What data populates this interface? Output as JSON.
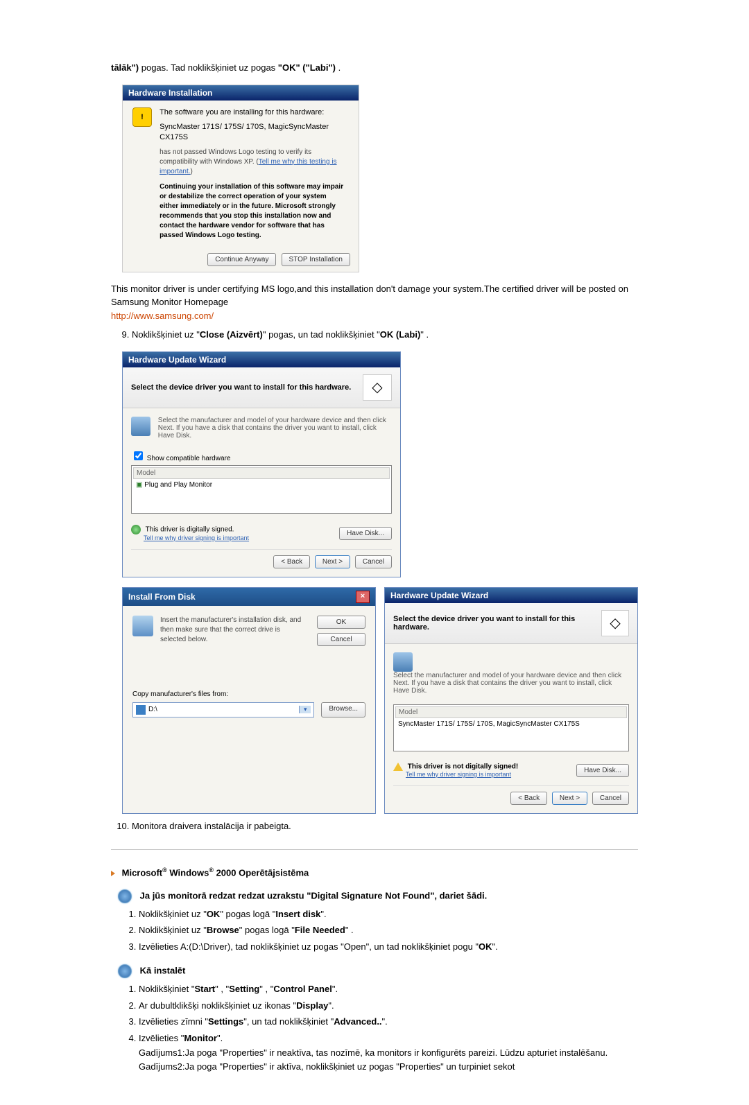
{
  "intro": {
    "line1_a": "tālāk\")",
    "line1_b": " pogas. Tad noklikšķiniet uz pogas ",
    "line1_c": "\"OK\" (\"Labi\")",
    "line1_d": " ."
  },
  "hw_install": {
    "title": "Hardware Installation",
    "l1": "The software you are installing for this hardware:",
    "l2": "SyncMaster 171S/ 175S/ 170S, MagicSyncMaster CX175S",
    "l3a": "has not passed Windows Logo testing to verify its compatibility with Windows XP. (",
    "l3link": "Tell me why this testing is important.",
    "l3b": ")",
    "bold": "Continuing your installation of this software may impair or destabilize the correct operation of your system either immediately or in the future. Microsoft strongly recommends that you stop this installation now and contact the hardware vendor for software that has passed Windows Logo testing.",
    "btn_cont": "Continue Anyway",
    "btn_stop": "STOP Installation"
  },
  "after_hw": {
    "p1": "This monitor driver is under certifying MS logo,and this installation don't damage your system.The certified driver will be posted on Samsung Monitor Homepage",
    "link": "http://www.samsung.com/"
  },
  "step9": {
    "a": "Noklikšķiniet uz \"",
    "close": "Close (Aizvērt)",
    "b": "\" pogas, un tad noklikšķiniet \"",
    "ok": "OK (Labi)",
    "c": "\" ."
  },
  "wiz1": {
    "title": "Hardware Update Wizard",
    "header": "Select the device driver you want to install for this hardware.",
    "note": "Select the manufacturer and model of your hardware device and then click Next. If you have a disk that contains the driver you want to install, click Have Disk.",
    "chk": "Show compatible hardware",
    "col": "Model",
    "row": "Plug and Play Monitor",
    "signed": "This driver is digitally signed.",
    "tell": "Tell me why driver signing is important",
    "have": "Have Disk...",
    "back": "< Back",
    "next": "Next >",
    "cancel": "Cancel"
  },
  "ifd": {
    "title": "Install From Disk",
    "text": "Insert the manufacturer's installation disk, and then make sure that the correct drive is selected below.",
    "ok": "OK",
    "cancel": "Cancel",
    "copy": "Copy manufacturer's files from:",
    "sel": "D:\\",
    "browse": "Browse..."
  },
  "wiz2": {
    "title": "Hardware Update Wizard",
    "header": "Select the device driver you want to install for this hardware.",
    "note": "Select the manufacturer and model of your hardware device and then click Next. If you have a disk that contains the driver you want to install, click Have Disk.",
    "col": "Model",
    "row": "SyncMaster 171S/ 175S/ 170S, MagicSyncMaster CX175S",
    "unsigned": "This driver is not digitally signed!",
    "tell": "Tell me why driver signing is important",
    "have": "Have Disk...",
    "back": "< Back",
    "next": "Next >",
    "cancel": "Cancel"
  },
  "step10": "Monitora draivera instalācija ir pabeigta.",
  "os_heading_a": "Microsoft",
  "os_heading_b": " Windows",
  "os_heading_c": " 2000 Operētājsistēma",
  "ds_heading": "Ja jūs monitorā redzat redzat uzrakstu \"Digital Signature Not Found\", dariet šādi.",
  "ds_list": {
    "i1a": "Noklikšķiniet uz \"",
    "i1b": "OK",
    "i1c": "\" pogas logā \"",
    "i1d": "Insert disk",
    "i1e": "\".",
    "i2a": "Noklikšķiniet uz \"",
    "i2b": "Browse",
    "i2c": "\" pogas logā \"",
    "i2d": "File Needed",
    "i2e": "\" .",
    "i3a": "Izvēlieties A:(D:\\Driver), tad noklikšķiniet uz pogas \"Open\", un tad noklikšķiniet pogu \"",
    "i3b": "OK",
    "i3c": "\"."
  },
  "inst_heading": "Kā instalēt",
  "inst_list": {
    "i1a": "Noklikšķiniet \"",
    "i1b": "Start",
    "i1c": "\" , \"",
    "i1d": "Setting",
    "i1e": "\" , \"",
    "i1f": "Control Panel",
    "i1g": "\".",
    "i2a": "Ar dubultklikšķi noklikšķiniet uz ikonas \"",
    "i2b": "Display",
    "i2c": "\".",
    "i3a": "Izvēlieties zīmni \"",
    "i3b": "Settings",
    "i3c": "\", un tad noklikšķiniet \"",
    "i3d": "Advanced..",
    "i3e": "\".",
    "i4a": "Izvēlieties \"",
    "i4b": "Monitor",
    "i4c": "\".",
    "g1": "Gadījums1:Ja poga \"Properties\" ir neaktīva, tas nozīmē, ka monitors ir konfigurēts pareizi. Lūdzu apturiet instalēšanu.",
    "g2": "Gadījums2:Ja poga \"Properties\" ir aktīva, noklikšķiniet uz pogas \"Properties\" un turpiniet sekot"
  }
}
